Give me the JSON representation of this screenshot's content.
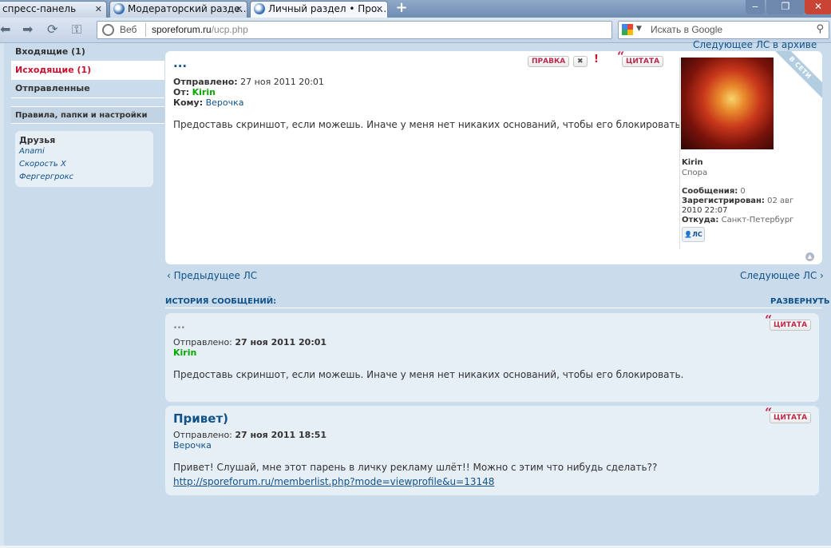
{
  "browser": {
    "tabs": [
      {
        "title": "спресс-панель",
        "close": "✕"
      },
      {
        "title": "Модераторский разде…",
        "close": "✕"
      },
      {
        "title": "Личный раздел • Про…",
        "close": "✕"
      }
    ],
    "new_tab": "+",
    "address": {
      "label": "Веб",
      "domain": "sporeforum.ru",
      "path": "/ucp.php"
    },
    "search_placeholder": "Искать в Google"
  },
  "sidebar": {
    "items": [
      {
        "label": "Входящие (1)",
        "active": false
      },
      {
        "label": "Исходящие (1)",
        "active": true
      },
      {
        "label": "Отправленные",
        "active": false
      }
    ],
    "settings": "Правила, папки и настройки",
    "friends_title": "Друзья",
    "friends": [
      "Anami",
      "Скорость X",
      "Фергергрокс"
    ]
  },
  "archive_link": "Следующее ЛС в архиве",
  "message": {
    "title": "...",
    "buttons": {
      "edit": "ПРАВКА",
      "delete": "✖",
      "report": "!",
      "quote": "ЦИТАТА"
    },
    "sent_label": "Отправлено:",
    "sent_value": "27 ноя 2011 20:01",
    "from_label": "От:",
    "from_value": "Kirin",
    "to_label": "Кому:",
    "to_value": "Верочка",
    "content": "Предоставь скриншот, если можешь. Иначе у меня нет никаких оснований, чтобы его блокировать.",
    "online": "В СЕТИ",
    "profile": {
      "name": "Kirin",
      "rank": "Спора",
      "posts_label": "Сообщения:",
      "posts_value": "0",
      "reg_label": "Зарегистрирован:",
      "reg_value_1": "02 авг",
      "reg_value_2": "2010 22:07",
      "from_label": "Откуда:",
      "from_value": "Санкт-Петербург",
      "pm_button": "ЛС"
    }
  },
  "nav": {
    "prev": "Предыдущее ЛС",
    "next": "Следующее ЛС"
  },
  "history": {
    "title": "ИСТОРИЯ СООБЩЕНИЙ:",
    "expand": "РАЗВЕРНУТЬ",
    "posts": [
      {
        "title": "...",
        "sent_label": "Отправлено:",
        "sent_value": "27 ноя 2011 20:01",
        "author": "Kirin",
        "content": "Предоставь скриншот, если можешь. Иначе у меня нет никаких оснований, чтобы его блокировать.",
        "quote": "ЦИТАТА"
      },
      {
        "title": "Привет)",
        "sent_label": "Отправлено:",
        "sent_value": "27 ноя 2011 18:51",
        "author": "Верочка",
        "content": "Привет! Слушай, мне этот парень в личку рекламу шлёт!! Можно с этим что нибудь сделать??",
        "link": "http://sporeforum.ru/memberlist.php?mode=viewprofile&u=13148",
        "quote": "ЦИТАТА"
      }
    ]
  },
  "colors": {
    "accent": "#105289",
    "active": "#c8102e",
    "online_green": "#00aa00",
    "bg": "#cadceb"
  }
}
